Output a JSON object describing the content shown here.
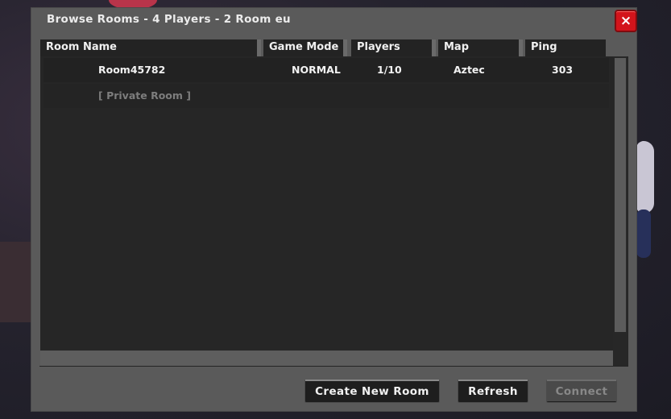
{
  "window": {
    "title": "Browse Rooms - 4 Players - 2 Room eu",
    "close_icon": "×"
  },
  "table": {
    "columns": [
      "Room Name",
      "Game Mode",
      "Players",
      "Map",
      "Ping"
    ],
    "rows": [
      {
        "room_name": "Room45782",
        "game_mode": "NORMAL",
        "players": "1/10",
        "map": "Aztec",
        "ping": "303"
      },
      {
        "room_name": "[ Private Room ]",
        "game_mode": "",
        "players": "",
        "map": "",
        "ping": ""
      }
    ]
  },
  "buttons": {
    "create": "Create New Room",
    "refresh": "Refresh",
    "connect": "Connect"
  },
  "colors": {
    "dialog_bg": "#5a5a5a",
    "list_bg": "#262626",
    "close_red": "#d3141b",
    "private_text": "#7d7d7d"
  }
}
